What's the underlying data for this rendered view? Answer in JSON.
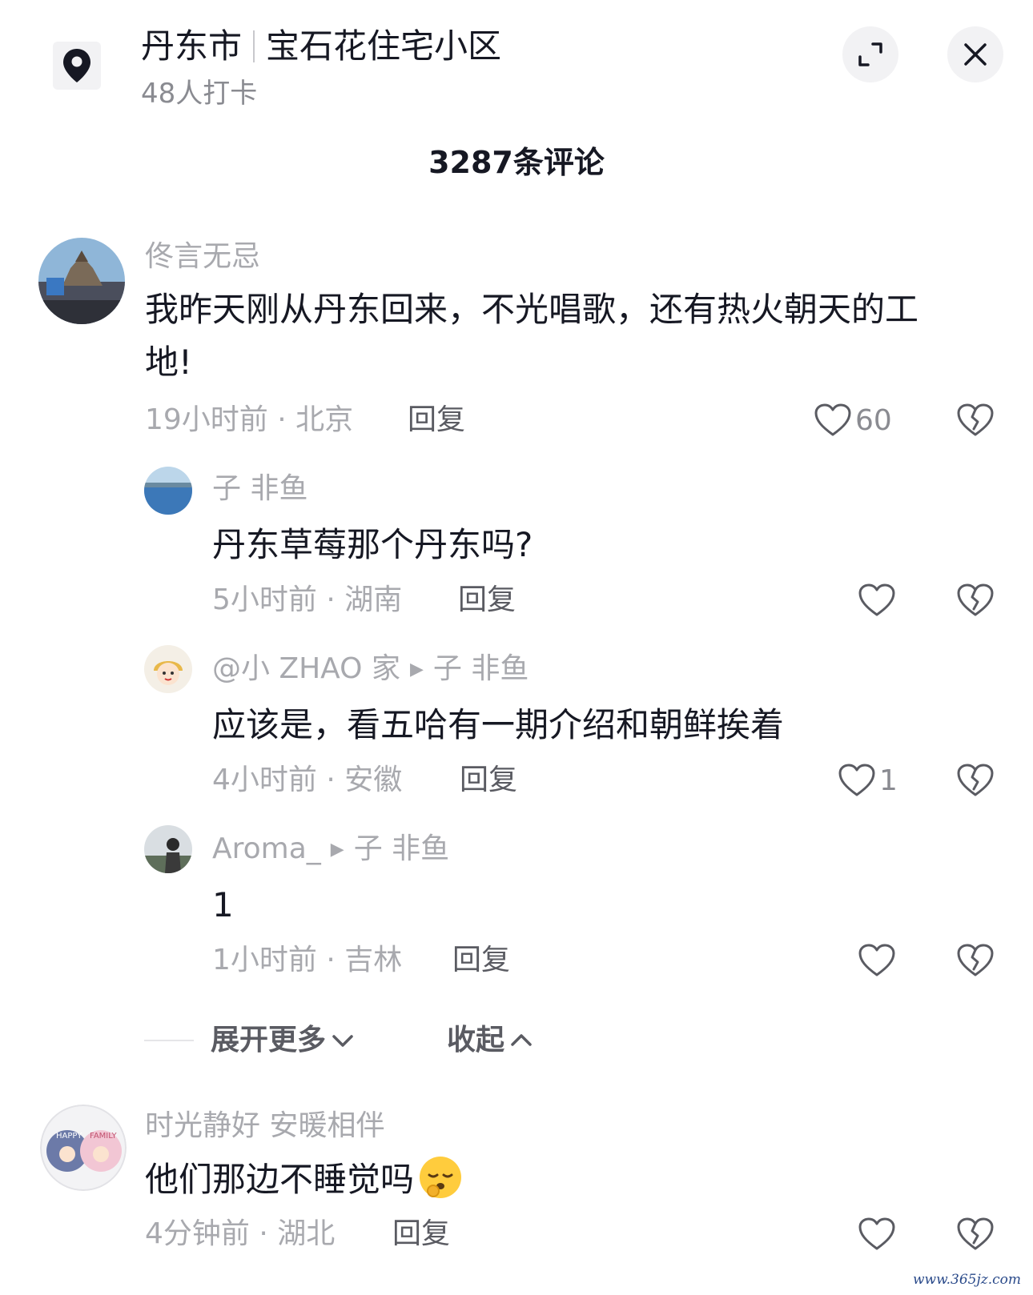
{
  "header": {
    "city": "丹东市",
    "place": "宝石花住宅小区",
    "checkins": "48人打卡",
    "location_icon": "location-pin-icon",
    "expand_icon": "expand-icon",
    "close_icon": "close-icon"
  },
  "comments_header": {
    "count_label": "3287条评论"
  },
  "comments": [
    {
      "username": "佟言无忌",
      "text_line1": "我昨天刚从丹东回来，不光唱歌，还有热火朝天的工",
      "text_line2": "地!",
      "time_location": "19小时前 · 北京",
      "reply_label": "回复",
      "likes": "60"
    },
    {
      "username": "子 非鱼",
      "text": "丹东草莓那个丹东吗?",
      "time_location": "5小时前 · 湖南",
      "reply_label": "回复",
      "likes": ""
    },
    {
      "username": "@小 ZHAO 家",
      "reply_to": "子 非鱼",
      "text": "应该是，看五哈有一期介绍和朝鲜挨着",
      "time_location": "4小时前 · 安徽",
      "reply_label": "回复",
      "likes": "1"
    },
    {
      "username": "Aroma_",
      "reply_to": "子 非鱼",
      "text": "1",
      "time_location": "1小时前 · 吉林",
      "reply_label": "回复",
      "likes": ""
    },
    {
      "username": "时光静好 安暖相伴",
      "text": "他们那边不睡觉吗",
      "time_location": "4分钟前 · 湖北",
      "reply_label": "回复",
      "likes": ""
    }
  ],
  "thread_controls": {
    "expand_more": "展开更多",
    "collapse": "收起"
  },
  "avatar_texts": {
    "family_badge_left": "HAPPY",
    "family_badge_right": "FAMILY"
  },
  "watermark": "www.365jz.com",
  "colors": {
    "text_primary": "#161823",
    "text_secondary": "#a8a9ae",
    "button_bg": "#f2f2f4"
  }
}
